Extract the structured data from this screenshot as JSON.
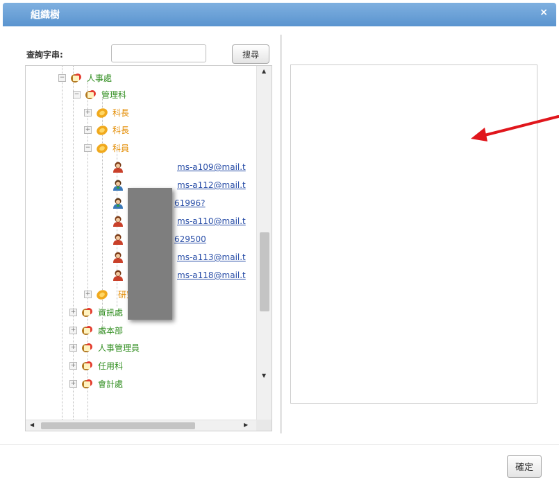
{
  "dialog": {
    "title": "組織樹",
    "close_glyph": "×"
  },
  "search": {
    "label": "查詢字串:",
    "value": "",
    "button_label": "搜尋"
  },
  "tree": {
    "nodes": [
      {
        "label": "人事處",
        "type": "org",
        "expanded": true
      },
      {
        "label": "管理科",
        "type": "org",
        "expanded": true
      },
      {
        "label": "科長",
        "type": "section",
        "expanded": false
      },
      {
        "label": "科長",
        "type": "section",
        "expanded": false
      },
      {
        "label": "科員",
        "type": "section",
        "expanded": true
      },
      {
        "label": "ms-a109@mail.t",
        "type": "user-female"
      },
      {
        "label": "ms-a112@mail.t",
        "type": "user-male"
      },
      {
        "label": "61996?",
        "type": "user-male"
      },
      {
        "label": "ms-a110@mail.t",
        "type": "user-female"
      },
      {
        "label": "629500",
        "type": "user-female"
      },
      {
        "label": "ms-a113@mail.t",
        "type": "user-female"
      },
      {
        "label": "ms-a118@mail.t",
        "type": "user-female"
      },
      {
        "label": "研究",
        "type": "section",
        "expanded": false
      },
      {
        "label": "資訊處",
        "type": "org",
        "expanded": false
      },
      {
        "label": "處本部",
        "type": "org",
        "expanded": false
      },
      {
        "label": "人事管理員",
        "type": "org",
        "expanded": false
      },
      {
        "label": "任用科",
        "type": "org",
        "expanded": false
      },
      {
        "label": "會計處",
        "type": "org",
        "expanded": false
      }
    ]
  },
  "footer": {
    "ok_label": "確定"
  },
  "colors": {
    "title_bar": "#6ea3d8",
    "org_label": "#2f8d1e",
    "section_label": "#e38b00",
    "link": "#2a4fa8",
    "annotation_arrow": "#e0161c"
  }
}
